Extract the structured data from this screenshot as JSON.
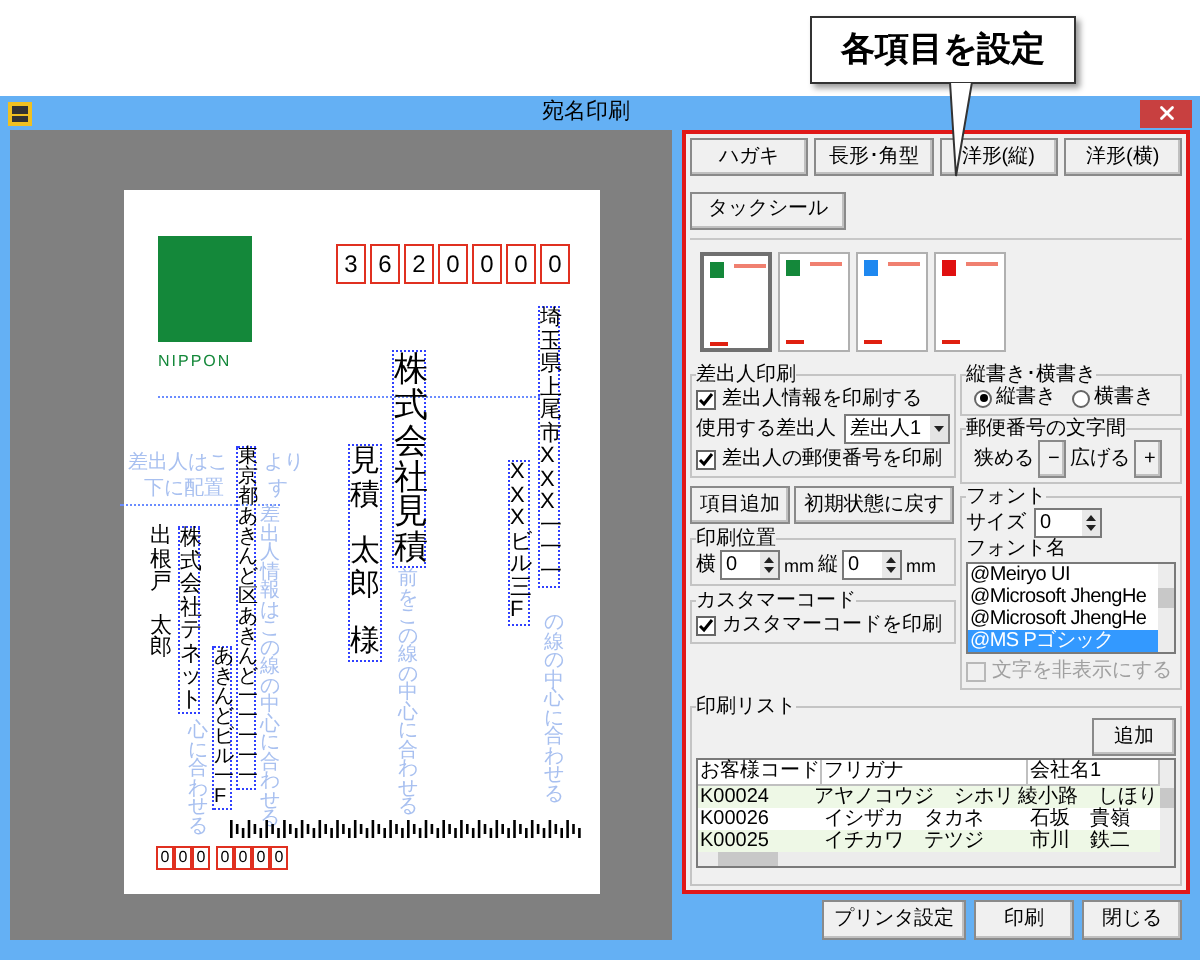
{
  "callout": {
    "text": "各項目を設定"
  },
  "window": {
    "title": "宛名印刷"
  },
  "preview": {
    "zip": [
      "3",
      "6",
      "2",
      "0",
      "0",
      "0",
      "0"
    ],
    "logo": "NIPPON",
    "address_1": "埼玉県上尾市XXX一一一",
    "address_2": "XXXビル三F",
    "company": "株式会社見積",
    "recipient": [
      "見積",
      "太郎",
      "様"
    ],
    "sender_address_1": "東京都あきんど区あきんど一一一一一",
    "sender_address_2": "あきんどビル一F",
    "sender_company": "株式会社テネット",
    "sender_name": [
      "出根戸",
      "太郎"
    ],
    "sender_zip": [
      "0",
      "0",
      "0",
      "0",
      "0",
      "0",
      "0"
    ],
    "guides": [
      "差出人はこ",
      "より",
      "下に配置",
      "す",
      "心に合わせる",
      "差出人情報はこの線の中心に合わせる",
      "前をこの線の中心に合わせる",
      "の線の中心に合わせる"
    ]
  },
  "panel": {
    "type_buttons": [
      "ハガキ",
      "長形･角型",
      "洋形(縦)",
      "洋形(横)",
      "タックシール"
    ],
    "thumbnails": [
      {
        "color": "#14883a",
        "selected": true
      },
      {
        "color": "#14883a",
        "selected": false
      },
      {
        "color": "#1e88f0",
        "selected": false
      },
      {
        "color": "#e01010",
        "selected": false
      }
    ],
    "sender": {
      "title": "差出人印刷",
      "print_sender": {
        "label": "差出人情報を印刷する",
        "checked": true
      },
      "use_label": "使用する差出人",
      "use_value": "差出人1",
      "print_zip": {
        "label": "差出人の郵便番号を印刷",
        "checked": true
      }
    },
    "direction": {
      "title": "縦書き･横書き",
      "options": [
        {
          "label": "縦書き",
          "selected": true
        },
        {
          "label": "横書き",
          "selected": false
        }
      ]
    },
    "zip_spacing": {
      "title": "郵便番号の文字間",
      "narrow": "狭める",
      "narrow_button": "−",
      "widen": "広げる",
      "widen_button": "+"
    },
    "add_item": "項目追加",
    "reset": "初期状態に戻す",
    "position": {
      "title": "印刷位置",
      "x_label": "横",
      "x_value": "0",
      "x_unit": "mm",
      "y_label": "縦",
      "y_value": "0",
      "y_unit": "mm"
    },
    "customer_code": {
      "title": "カスタマーコード",
      "label": "カスタマーコードを印刷",
      "checked": true
    },
    "font": {
      "title": "フォント",
      "size_label": "サイズ",
      "size_value": "0",
      "name_label": "フォント名",
      "names": [
        {
          "text": "@Meiryo UI",
          "selected": false
        },
        {
          "text": "@Microsoft JhengHe",
          "selected": false
        },
        {
          "text": "@Microsoft JhengHe",
          "selected": false
        },
        {
          "text": "@MS Pゴシック",
          "selected": true
        }
      ],
      "hide_text": {
        "label": "文字を非表示にする",
        "checked": false,
        "disabled": true
      }
    },
    "print_list": {
      "title": "印刷リスト",
      "add": "追加",
      "columns": [
        "お客様コード",
        "フリガナ",
        "会社名1"
      ],
      "rows": [
        [
          "K00024",
          "アヤノコウジ　シホリ",
          "綾小路　しほり"
        ],
        [
          "K00026",
          "イシザカ　タカネ",
          "石坂　貴嶺"
        ],
        [
          "K00025",
          "イチカワ　テツジ",
          "市川　鉄二"
        ]
      ]
    }
  },
  "buttons": [
    "プリンタ設定",
    "印刷",
    "閉じる"
  ]
}
